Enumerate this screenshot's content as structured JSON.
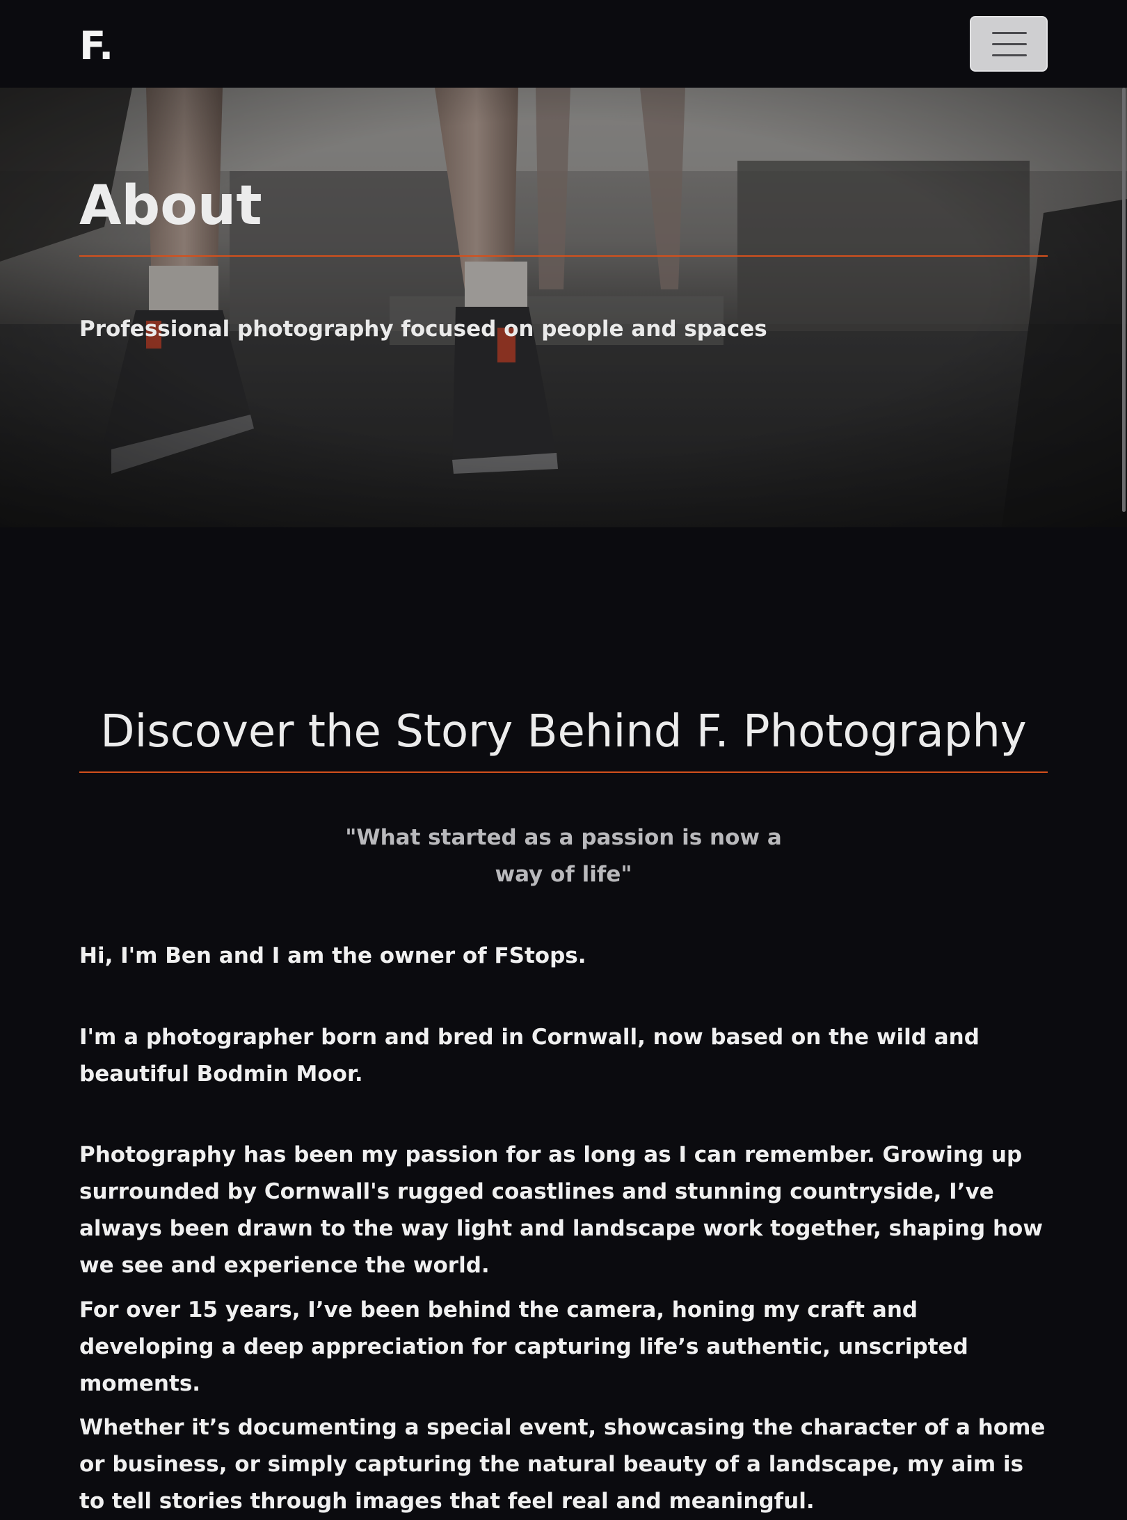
{
  "nav": {
    "brand": "F.",
    "menu_icon": "hamburger-menu-icon"
  },
  "hero": {
    "title": "About",
    "subtitle": "Professional photography focused on people and spaces",
    "accent_color": "#d4501c"
  },
  "story": {
    "heading": "Discover the Story Behind F. Photography",
    "quote": "\"What started as a passion is now a way of life\"",
    "paragraphs": [
      "Hi, I'm Ben and I am the owner of FStops.",
      "I'm a photographer born and bred in Cornwall, now based on the wild and beautiful Bodmin Moor.",
      "Photography has been my passion for as long as I can remember. Growing up surrounded by Cornwall's rugged coastlines and stunning countryside, I’ve always been drawn to the way light and landscape work together, shaping how we see and experience the world.",
      "For over 15 years, I’ve been behind the camera, honing my craft and developing a deep appreciation for capturing life’s authentic, unscripted moments.",
      "Whether it’s documenting a special event, showcasing the character of a home or business, or simply capturing the natural beauty of a landscape, my aim is to tell stories through images that feel real and meaningful."
    ]
  }
}
